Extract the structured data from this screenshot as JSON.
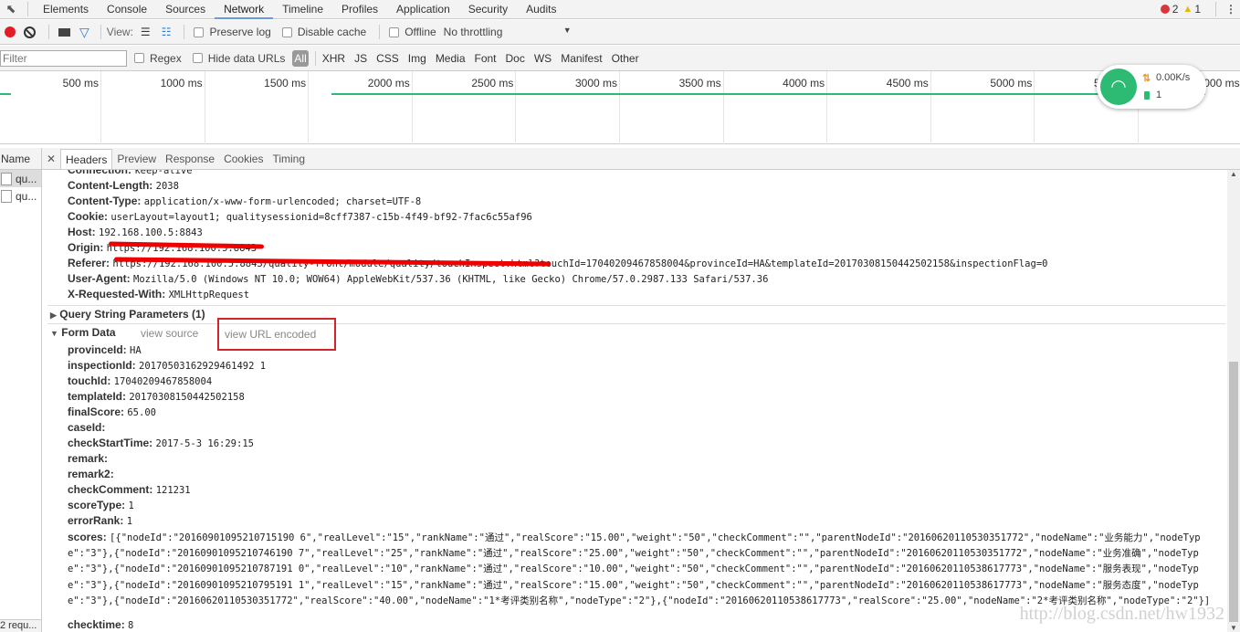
{
  "tabs": [
    "Elements",
    "Console",
    "Sources",
    "Network",
    "Timeline",
    "Profiles",
    "Application",
    "Security",
    "Audits"
  ],
  "active_tab": "Network",
  "status": {
    "errors": "2",
    "warnings": "1"
  },
  "toolbar": {
    "view_label": "View:",
    "preserve_log": "Preserve log",
    "disable_cache": "Disable cache",
    "offline": "Offline",
    "throttling": "No throttling"
  },
  "filterbar": {
    "filter_placeholder": "Filter",
    "regex": "Regex",
    "hide_data_urls": "Hide data URLs",
    "types": [
      "All",
      "XHR",
      "JS",
      "CSS",
      "Img",
      "Media",
      "Font",
      "Doc",
      "WS",
      "Manifest",
      "Other"
    ]
  },
  "timeline": {
    "ticks": [
      "500 ms",
      "1000 ms",
      "1500 ms",
      "2000 ms",
      "2500 ms",
      "3000 ms",
      "3500 ms",
      "4000 ms",
      "4500 ms",
      "5000 ms",
      "5500 ms",
      "6000 ms"
    ]
  },
  "widget": {
    "speed": "0.00K/s",
    "count": "1",
    "color": "#2dba73"
  },
  "requests": {
    "header": "Name",
    "items": [
      "qu...",
      "qu..."
    ],
    "footer": "2 requ..."
  },
  "detail_tabs": [
    "Headers",
    "Preview",
    "Response",
    "Cookies",
    "Timing"
  ],
  "request_headers": [
    {
      "k": "Connection:",
      "v": "keep-alive"
    },
    {
      "k": "Content-Length:",
      "v": "2038"
    },
    {
      "k": "Content-Type:",
      "v": "application/x-www-form-urlencoded; charset=UTF-8"
    },
    {
      "k": "Cookie:",
      "v": "userLayout=layout1; qualitysessionid=8cff7387-c15b-4f49-bf92-7fac6c55af96"
    },
    {
      "k": "Host:",
      "v": "192.168.100.5:8843"
    },
    {
      "k": "Origin:",
      "v": "https://192.168.100.5:8843"
    },
    {
      "k": "Referer:",
      "v": "https://192.168.100.5:8843/quality-front/module/quality/touchInspect.html?touchId=17040209467858004&provinceId=HA&templateId=20170308150442502158&inspectionFlag=0"
    },
    {
      "k": "User-Agent:",
      "v": "Mozilla/5.0 (Windows NT 10.0; WOW64) AppleWebKit/537.36 (KHTML, like Gecko) Chrome/57.0.2987.133 Safari/537.36"
    },
    {
      "k": "X-Requested-With:",
      "v": "XMLHttpRequest"
    }
  ],
  "query_section": "Query String Parameters (1)",
  "form_section": {
    "title": "Form Data",
    "view_source": "view source",
    "view_url_encoded": "view URL encoded"
  },
  "form_data": [
    {
      "k": "provinceId:",
      "v": "HA"
    },
    {
      "k": "inspectionId:",
      "v": "20170503162929461492 1"
    },
    {
      "k": "touchId:",
      "v": "17040209467858004"
    },
    {
      "k": "templateId:",
      "v": "20170308150442502158"
    },
    {
      "k": "finalScore:",
      "v": "65.00"
    },
    {
      "k": "caseId:",
      "v": ""
    },
    {
      "k": "checkStartTime:",
      "v": "2017-5-3 16:29:15"
    },
    {
      "k": "remark:",
      "v": ""
    },
    {
      "k": "remark2:",
      "v": ""
    },
    {
      "k": "checkComment:",
      "v": "121231"
    },
    {
      "k": "scoreType:",
      "v": "1"
    },
    {
      "k": "errorRank:",
      "v": "1"
    }
  ],
  "scores": {
    "k": "scores:",
    "v": "[{\"nodeId\":\"20160901095210715190 6\",\"realLevel\":\"15\",\"rankName\":\"通过\",\"realScore\":\"15.00\",\"weight\":\"50\",\"checkComment\":\"\",\"parentNodeId\":\"20160620110530351772\",\"nodeName\":\"业务能力\",\"nodeType\":\"3\"},{\"nodeId\":\"20160901095210746190 7\",\"realLevel\":\"25\",\"rankName\":\"通过\",\"realScore\":\"25.00\",\"weight\":\"50\",\"checkComment\":\"\",\"parentNodeId\":\"20160620110530351772\",\"nodeName\":\"业务准确\",\"nodeType\":\"3\"},{\"nodeId\":\"20160901095210787191 0\",\"realLevel\":\"10\",\"rankName\":\"通过\",\"realScore\":\"10.00\",\"weight\":\"50\",\"checkComment\":\"\",\"parentNodeId\":\"20160620110538617773\",\"nodeName\":\"服务表现\",\"nodeType\":\"3\"},{\"nodeId\":\"20160901095210795191 1\",\"realLevel\":\"15\",\"rankName\":\"通过\",\"realScore\":\"15.00\",\"weight\":\"50\",\"checkComment\":\"\",\"parentNodeId\":\"20160620110538617773\",\"nodeName\":\"服务态度\",\"nodeType\":\"3\"},{\"nodeId\":\"20160620110530351772\",\"realScore\":\"40.00\",\"nodeName\":\"1*考评类别名称\",\"nodeType\":\"2\"},{\"nodeId\":\"20160620110538617773\",\"realScore\":\"25.00\",\"nodeName\":\"2*考评类别名称\",\"nodeType\":\"2\"}]"
  },
  "checktime": {
    "k": "checktime:",
    "v": "8"
  },
  "watermark": "http://blog.csdn.net/hw1932"
}
